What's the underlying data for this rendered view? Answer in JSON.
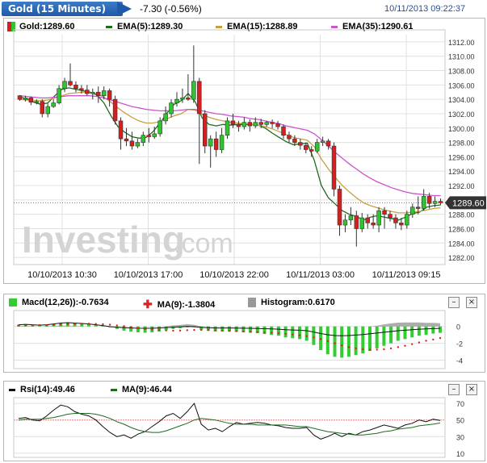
{
  "header": {
    "title": "Gold (15 Minutes)",
    "change": "-7.30 (-0.56%)",
    "timestamp": "10/11/2013 09:22:37"
  },
  "main_legend": {
    "gold": "Gold:1289.60",
    "ema5": "EMA(5):1289.30",
    "ema15": "EMA(15):1288.89",
    "ema35": "EMA(35):1290.61"
  },
  "watermark": {
    "brand": "Investing",
    "suffix": ".com"
  },
  "price_tag": "1289.60",
  "macd_legend": {
    "macd": "Macd(12,26)):-0.7634",
    "ma": "MA(9):-1.3804",
    "hist": "Histogram:0.6170"
  },
  "rsi_legend": {
    "rsi": "Rsi(14):49.46",
    "ma": "MA(9):46.44"
  },
  "buttons": {
    "minimize": "–",
    "close": "×"
  },
  "colors": {
    "up": "#2ec52e",
    "down": "#d42020",
    "ema5": "#1e6a1e",
    "ema15": "#c8a040",
    "ema35": "#cc55cc",
    "macd_hist": "#33cc33",
    "signal": "#e02020",
    "grid": "#e0e0e0"
  },
  "chart_data": [
    {
      "type": "candlestick",
      "title": "Gold (15 Minutes)",
      "y_ticks": [
        "1312.00",
        "1310.00",
        "1308.00",
        "1306.00",
        "1304.00",
        "1302.00",
        "1300.00",
        "1298.00",
        "1296.00",
        "1294.00",
        "1292.00",
        "1290.00",
        "1288.00",
        "1286.00",
        "1284.00",
        "1282.00"
      ],
      "ylim": [
        1281,
        1313
      ],
      "x_ticks": [
        "10/10/2013 10:30",
        "10/10/2013 17:00",
        "10/10/2013 22:00",
        "10/11/2013 03:00",
        "10/11/2013 09:15"
      ],
      "candles": [
        [
          1304.5,
          1304.0,
          1304.6,
          1303.8
        ],
        [
          1304.0,
          1304.2,
          1304.5,
          1303.7
        ],
        [
          1304.2,
          1303.6,
          1304.4,
          1303.2
        ],
        [
          1303.6,
          1303.7,
          1304.0,
          1303.3
        ],
        [
          1303.7,
          1302.0,
          1304.0,
          1301.5
        ],
        [
          1302.0,
          1303.0,
          1303.4,
          1301.5
        ],
        [
          1303.0,
          1303.5,
          1304.0,
          1302.8
        ],
        [
          1303.5,
          1305.5,
          1306.0,
          1303.3
        ],
        [
          1305.5,
          1306.5,
          1307.0,
          1305.0
        ],
        [
          1306.5,
          1306.0,
          1309.0,
          1305.8
        ],
        [
          1306.0,
          1305.5,
          1306.5,
          1305.0
        ],
        [
          1305.5,
          1305.3,
          1306.0,
          1304.8
        ],
        [
          1305.3,
          1304.8,
          1306.0,
          1304.5
        ],
        [
          1304.8,
          1305.0,
          1305.5,
          1304.0
        ],
        [
          1305.0,
          1304.5,
          1305.8,
          1303.5
        ],
        [
          1304.5,
          1305.2,
          1305.8,
          1304.0
        ],
        [
          1305.2,
          1304.0,
          1305.5,
          1303.0
        ],
        [
          1304.0,
          1301.0,
          1304.5,
          1300.5
        ],
        [
          1301.0,
          1298.5,
          1301.5,
          1297.0
        ],
        [
          1298.5,
          1298.2,
          1300.0,
          1297.5
        ],
        [
          1298.2,
          1297.5,
          1299.5,
          1297.0
        ],
        [
          1297.5,
          1298.0,
          1298.5,
          1297.2
        ],
        [
          1298.0,
          1299.0,
          1299.5,
          1297.5
        ],
        [
          1299.0,
          1298.8,
          1300.0,
          1298.0
        ],
        [
          1298.8,
          1299.2,
          1300.2,
          1298.5
        ],
        [
          1299.2,
          1301.0,
          1301.5,
          1298.8
        ],
        [
          1301.0,
          1302.0,
          1303.0,
          1300.5
        ],
        [
          1302.0,
          1303.5,
          1304.0,
          1301.5
        ],
        [
          1303.5,
          1304.0,
          1305.0,
          1303.0
        ],
        [
          1304.0,
          1304.2,
          1305.5,
          1303.5
        ],
        [
          1304.2,
          1304.0,
          1307.5,
          1303.8
        ],
        [
          1304.0,
          1306.5,
          1311.5,
          1303.5
        ],
        [
          1306.5,
          1302.0,
          1307.0,
          1295.0
        ],
        [
          1302.0,
          1297.5,
          1302.5,
          1296.5
        ],
        [
          1297.5,
          1298.5,
          1299.0,
          1294.5
        ],
        [
          1298.5,
          1297.0,
          1299.5,
          1296.0
        ],
        [
          1297.0,
          1299.0,
          1300.0,
          1296.5
        ],
        [
          1299.0,
          1301.0,
          1301.5,
          1298.5
        ],
        [
          1301.0,
          1300.5,
          1302.0,
          1300.0
        ],
        [
          1300.5,
          1300.2,
          1301.0,
          1299.5
        ],
        [
          1300.2,
          1300.8,
          1301.5,
          1299.8
        ],
        [
          1300.8,
          1300.3,
          1301.2,
          1299.5
        ],
        [
          1300.3,
          1300.8,
          1301.5,
          1300.0
        ],
        [
          1300.8,
          1300.5,
          1301.3,
          1300.0
        ],
        [
          1300.5,
          1300.8,
          1301.0,
          1300.2
        ],
        [
          1300.8,
          1300.6,
          1301.2,
          1300.0
        ],
        [
          1300.6,
          1300.2,
          1301.0,
          1299.8
        ],
        [
          1300.2,
          1299.0,
          1300.5,
          1298.5
        ],
        [
          1299.0,
          1298.5,
          1299.5,
          1298.0
        ],
        [
          1298.5,
          1298.0,
          1299.0,
          1297.5
        ],
        [
          1298.0,
          1297.6,
          1298.5,
          1297.0
        ],
        [
          1297.6,
          1297.0,
          1298.0,
          1296.5
        ],
        [
          1297.0,
          1296.8,
          1297.5,
          1296.0
        ],
        [
          1296.8,
          1298.0,
          1298.5,
          1296.5
        ],
        [
          1298.0,
          1298.2,
          1298.8,
          1297.5
        ],
        [
          1298.2,
          1297.5,
          1298.5,
          1297.0
        ],
        [
          1297.5,
          1291.5,
          1298.0,
          1290.5
        ],
        [
          1291.5,
          1286.5,
          1292.0,
          1285.0
        ],
        [
          1286.5,
          1287.2,
          1288.0,
          1285.5
        ],
        [
          1287.2,
          1287.8,
          1289.0,
          1286.5
        ],
        [
          1287.8,
          1286.0,
          1288.5,
          1283.5
        ],
        [
          1286.0,
          1287.5,
          1288.2,
          1285.5
        ],
        [
          1287.5,
          1286.8,
          1288.0,
          1286.0
        ],
        [
          1286.8,
          1286.5,
          1288.0,
          1286.0
        ],
        [
          1286.5,
          1288.5,
          1289.0,
          1285.5
        ],
        [
          1288.5,
          1288.0,
          1289.0,
          1286.0
        ],
        [
          1288.0,
          1287.5,
          1288.5,
          1287.0
        ],
        [
          1287.5,
          1286.8,
          1288.0,
          1286.0
        ],
        [
          1286.8,
          1286.5,
          1287.5,
          1285.8
        ],
        [
          1286.5,
          1288.0,
          1288.5,
          1286.0
        ],
        [
          1288.0,
          1289.0,
          1289.5,
          1287.5
        ],
        [
          1289.0,
          1288.8,
          1290.5,
          1288.0
        ],
        [
          1288.8,
          1290.5,
          1291.5,
          1288.5
        ],
        [
          1290.5,
          1289.5,
          1291.0,
          1288.8
        ],
        [
          1289.5,
          1289.8,
          1290.5,
          1289.0
        ],
        [
          1289.8,
          1289.6,
          1290.2,
          1289.3
        ]
      ],
      "series": [
        {
          "name": "EMA(5)",
          "values": [
            1304.3,
            1304.1,
            1303.6,
            1303.3,
            1303.5,
            1304.5,
            1305.4,
            1305.6,
            1305.4,
            1305.2,
            1305.0,
            1304.6,
            1303.5,
            1301.7,
            1300.2,
            1299.4,
            1298.8,
            1298.6,
            1298.7,
            1299.5,
            1300.7,
            1302.1,
            1303.3,
            1303.8,
            1304.8,
            1303.7,
            1301.4,
            1300.5,
            1300.3,
            1300.5,
            1300.4,
            1300.5,
            1300.5,
            1300.5,
            1300.4,
            1300.0,
            1299.3,
            1298.7,
            1298.1,
            1297.7,
            1297.8,
            1297.9,
            1295.5,
            1292.0,
            1290.3,
            1289.4,
            1288.5,
            1288.0,
            1287.7,
            1287.2,
            1287.6,
            1287.8,
            1287.6,
            1287.4,
            1287.2,
            1287.6,
            1288.1,
            1288.3,
            1289.0,
            1289.2,
            1289.3
          ]
        },
        {
          "name": "EMA(15)",
          "values": [
            1304.0,
            1303.9,
            1303.8,
            1303.8,
            1303.9,
            1304.2,
            1304.5,
            1304.8,
            1304.9,
            1305.0,
            1304.9,
            1304.8,
            1304.3,
            1303.6,
            1302.8,
            1302.1,
            1301.5,
            1301.0,
            1300.7,
            1300.7,
            1300.9,
            1301.3,
            1301.7,
            1302.0,
            1302.6,
            1302.5,
            1301.9,
            1301.5,
            1301.2,
            1301.0,
            1300.8,
            1300.7,
            1300.6,
            1300.5,
            1300.4,
            1300.2,
            1299.9,
            1299.5,
            1299.1,
            1298.7,
            1298.5,
            1298.3,
            1297.4,
            1295.7,
            1294.3,
            1293.1,
            1292.0,
            1291.1,
            1290.3,
            1289.6,
            1289.2,
            1288.9,
            1288.6,
            1288.4,
            1288.2,
            1288.2,
            1288.3,
            1288.4,
            1288.6,
            1288.8,
            1288.9
          ]
        },
        {
          "name": "EMA(35)",
          "values": [
            1304.5,
            1304.4,
            1304.3,
            1304.2,
            1304.2,
            1304.3,
            1304.4,
            1304.5,
            1304.5,
            1304.5,
            1304.5,
            1304.4,
            1304.2,
            1303.9,
            1303.6,
            1303.3,
            1303.0,
            1302.8,
            1302.6,
            1302.5,
            1302.4,
            1302.4,
            1302.4,
            1302.5,
            1302.6,
            1302.6,
            1302.4,
            1302.2,
            1302.0,
            1301.9,
            1301.7,
            1301.6,
            1301.5,
            1301.3,
            1301.2,
            1301.0,
            1300.8,
            1300.6,
            1300.3,
            1300.1,
            1299.9,
            1299.7,
            1299.2,
            1298.4,
            1297.5,
            1296.6,
            1295.8,
            1295.0,
            1294.3,
            1293.6,
            1293.0,
            1292.5,
            1292.1,
            1291.7,
            1291.4,
            1291.1,
            1290.9,
            1290.8,
            1290.7,
            1290.6,
            1290.6
          ]
        }
      ]
    },
    {
      "type": "bar",
      "title": "Macd(12,26))",
      "y_ticks": [
        "0",
        "-2",
        "-4"
      ],
      "ylim": [
        -5,
        1.5
      ],
      "series": [
        {
          "name": "Macd(12,26))",
          "values": [
            0.2,
            0.25,
            0.2,
            0.15,
            0.2,
            0.3,
            0.4,
            0.45,
            0.4,
            0.35,
            0.3,
            0.2,
            0.1,
            -0.1,
            -0.3,
            -0.5,
            -0.6,
            -0.7,
            -0.75,
            -0.7,
            -0.6,
            -0.45,
            -0.3,
            -0.2,
            0.0,
            -0.1,
            -0.4,
            -0.5,
            -0.6,
            -0.6,
            -0.6,
            -0.65,
            -0.7,
            -0.75,
            -0.8,
            -0.9,
            -1.0,
            -1.1,
            -1.3,
            -1.4,
            -1.5,
            -1.7,
            -2.2,
            -2.8,
            -3.3,
            -3.6,
            -3.7,
            -3.6,
            -3.4,
            -3.2,
            -2.9,
            -2.6,
            -2.3,
            -2.0,
            -1.7,
            -1.5,
            -1.3,
            -1.1,
            -1.0,
            -0.85,
            -0.76
          ]
        },
        {
          "name": "MA(9)",
          "values": [
            0.1,
            0.12,
            0.14,
            0.15,
            0.16,
            0.18,
            0.22,
            0.27,
            0.3,
            0.32,
            0.32,
            0.3,
            0.26,
            0.2,
            0.12,
            0.03,
            -0.08,
            -0.2,
            -0.3,
            -0.38,
            -0.44,
            -0.48,
            -0.5,
            -0.49,
            -0.45,
            -0.42,
            -0.42,
            -0.44,
            -0.47,
            -0.5,
            -0.53,
            -0.56,
            -0.59,
            -0.62,
            -0.66,
            -0.7,
            -0.75,
            -0.81,
            -0.88,
            -0.96,
            -1.05,
            -1.15,
            -1.3,
            -1.5,
            -1.75,
            -2.0,
            -2.25,
            -2.45,
            -2.6,
            -2.7,
            -2.75,
            -2.75,
            -2.7,
            -2.6,
            -2.45,
            -2.3,
            -2.1,
            -1.9,
            -1.7,
            -1.55,
            -1.38
          ]
        },
        {
          "name": "Histogram",
          "values": [
            0.1,
            0.13,
            0.06,
            0.0,
            0.04,
            0.12,
            0.18,
            0.18,
            0.1,
            0.03,
            -0.02,
            -0.1,
            -0.16,
            -0.3,
            -0.42,
            -0.53,
            -0.52,
            -0.5,
            -0.45,
            -0.32,
            -0.16,
            0.03,
            0.2,
            0.29,
            0.45,
            0.32,
            0.02,
            -0.06,
            -0.13,
            -0.1,
            -0.07,
            -0.09,
            -0.11,
            -0.13,
            -0.14,
            -0.2,
            -0.25,
            -0.29,
            -0.42,
            -0.44,
            -0.45,
            -0.55,
            -0.9,
            -1.3,
            -1.55,
            -1.6,
            -1.45,
            -1.15,
            -0.8,
            -0.5,
            -0.15,
            0.15,
            0.4,
            0.6,
            0.75,
            0.8,
            0.8,
            0.8,
            0.7,
            0.7,
            0.62
          ]
        }
      ]
    },
    {
      "type": "line",
      "title": "Rsi(14)",
      "y_ticks": [
        "70",
        "50",
        "30",
        "10"
      ],
      "ylim": [
        5,
        75
      ],
      "series": [
        {
          "name": "Rsi(14)",
          "values": [
            52,
            53,
            50,
            49,
            55,
            62,
            68,
            66,
            60,
            57,
            55,
            50,
            42,
            35,
            30,
            32,
            28,
            33,
            36,
            42,
            48,
            55,
            58,
            52,
            60,
            70,
            45,
            38,
            40,
            36,
            42,
            47,
            45,
            46,
            47,
            46,
            44,
            43,
            41,
            40,
            40,
            41,
            32,
            27,
            30,
            34,
            30,
            34,
            32,
            36,
            38,
            41,
            44,
            42,
            40,
            44,
            46,
            50,
            48,
            51,
            49.46
          ]
        },
        {
          "name": "MA(9)",
          "values": [
            50,
            51,
            51,
            51,
            52,
            53,
            55,
            57,
            58,
            58,
            58,
            57,
            55,
            52,
            48,
            45,
            41,
            38,
            36,
            35,
            35,
            37,
            40,
            43,
            46,
            50,
            52,
            51,
            50,
            48,
            46,
            45,
            45,
            45,
            44,
            44,
            44,
            44,
            44,
            43,
            42,
            42,
            40,
            38,
            36,
            35,
            34,
            33,
            32,
            32,
            33,
            34,
            36,
            37,
            39,
            40,
            41,
            43,
            44,
            45,
            46.44
          ]
        }
      ]
    }
  ]
}
